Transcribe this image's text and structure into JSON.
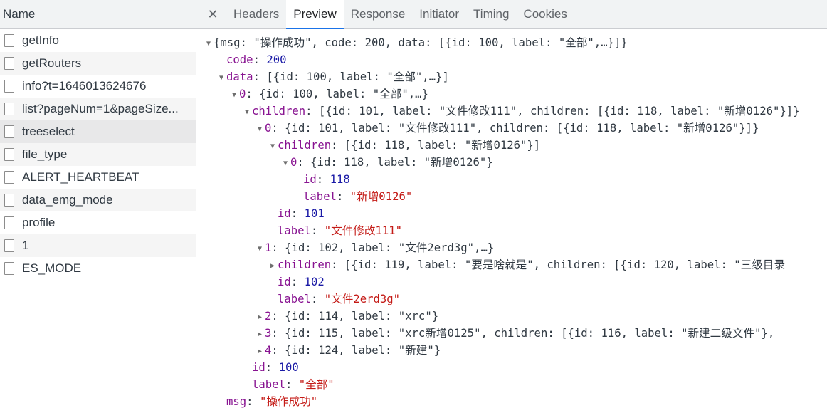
{
  "left_panel": {
    "header": "Name",
    "requests": [
      {
        "name": "getInfo"
      },
      {
        "name": "getRouters"
      },
      {
        "name": "info?t=1646013624676"
      },
      {
        "name": "list?pageNum=1&pageSize..."
      },
      {
        "name": "treeselect",
        "selected": true
      },
      {
        "name": "file_type"
      },
      {
        "name": "ALERT_HEARTBEAT"
      },
      {
        "name": "data_emg_mode"
      },
      {
        "name": "profile"
      },
      {
        "name": "1"
      },
      {
        "name": "ES_MODE"
      }
    ]
  },
  "tabs": {
    "close_icon": "close-icon",
    "items": [
      "Headers",
      "Preview",
      "Response",
      "Initiator",
      "Timing",
      "Cookies"
    ],
    "active": "Preview"
  },
  "json_preview": [
    {
      "indent": 0,
      "toggle": "expanded",
      "summary": "{msg: \"操作成功\", code: 200, data: [{id: 100, label: \"全部\",…}]}"
    },
    {
      "indent": 1,
      "toggle": "none",
      "key": "code",
      "type": "num",
      "value": "200"
    },
    {
      "indent": 1,
      "toggle": "expanded",
      "key": "data",
      "summary": "[{id: 100, label: \"全部\",…}]"
    },
    {
      "indent": 2,
      "toggle": "expanded",
      "key": "0",
      "summary": "{id: 100, label: \"全部\",…}"
    },
    {
      "indent": 3,
      "toggle": "expanded",
      "key": "children",
      "summary": "[{id: 101, label: \"文件修改111\", children: [{id: 118, label: \"新增0126\"}]}"
    },
    {
      "indent": 4,
      "toggle": "expanded",
      "key": "0",
      "summary": "{id: 101, label: \"文件修改111\", children: [{id: 118, label: \"新增0126\"}]}"
    },
    {
      "indent": 5,
      "toggle": "expanded",
      "key": "children",
      "summary": "[{id: 118, label: \"新增0126\"}]"
    },
    {
      "indent": 6,
      "toggle": "expanded",
      "key": "0",
      "summary": "{id: 118, label: \"新增0126\"}"
    },
    {
      "indent": 7,
      "toggle": "none",
      "key": "id",
      "type": "num",
      "value": "118"
    },
    {
      "indent": 7,
      "toggle": "none",
      "key": "label",
      "type": "str",
      "value": "\"新增0126\""
    },
    {
      "indent": 5,
      "toggle": "none",
      "key": "id",
      "type": "num",
      "value": "101"
    },
    {
      "indent": 5,
      "toggle": "none",
      "key": "label",
      "type": "str",
      "value": "\"文件修改111\""
    },
    {
      "indent": 4,
      "toggle": "expanded",
      "key": "1",
      "summary": "{id: 102, label: \"文件2erd3g\",…}"
    },
    {
      "indent": 5,
      "toggle": "collapsed",
      "key": "children",
      "summary": "[{id: 119, label: \"要是啥就是\", children: [{id: 120, label: \"三级目录"
    },
    {
      "indent": 5,
      "toggle": "none",
      "key": "id",
      "type": "num",
      "value": "102"
    },
    {
      "indent": 5,
      "toggle": "none",
      "key": "label",
      "type": "str",
      "value": "\"文件2erd3g\""
    },
    {
      "indent": 4,
      "toggle": "collapsed",
      "key": "2",
      "summary": "{id: 114, label: \"xrc\"}"
    },
    {
      "indent": 4,
      "toggle": "collapsed",
      "key": "3",
      "summary": "{id: 115, label: \"xrc新增0125\", children: [{id: 116, label: \"新建二级文件\"},"
    },
    {
      "indent": 4,
      "toggle": "collapsed",
      "key": "4",
      "summary": "{id: 124, label: \"新建\"}"
    },
    {
      "indent": 3,
      "toggle": "none",
      "key": "id",
      "type": "num",
      "value": "100"
    },
    {
      "indent": 3,
      "toggle": "none",
      "key": "label",
      "type": "str",
      "value": "\"全部\""
    },
    {
      "indent": 1,
      "toggle": "none",
      "key": "msg",
      "type": "str",
      "value": "\"操作成功\""
    }
  ]
}
